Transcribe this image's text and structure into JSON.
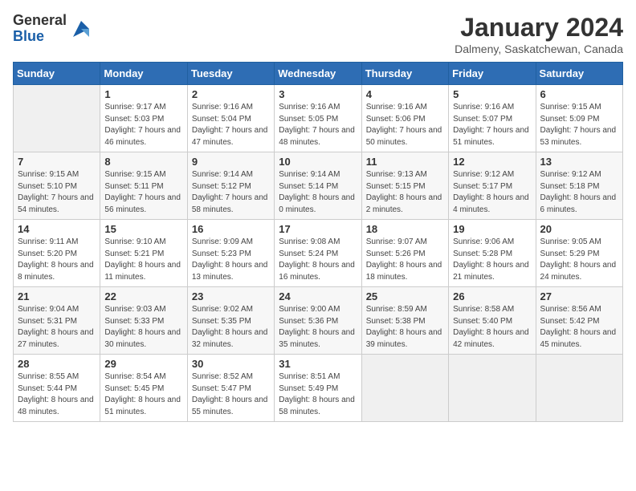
{
  "header": {
    "logo_general": "General",
    "logo_blue": "Blue",
    "month_title": "January 2024",
    "location": "Dalmeny, Saskatchewan, Canada"
  },
  "days_of_week": [
    "Sunday",
    "Monday",
    "Tuesday",
    "Wednesday",
    "Thursday",
    "Friday",
    "Saturday"
  ],
  "weeks": [
    [
      {
        "day": "",
        "sunrise": "",
        "sunset": "",
        "daylight": ""
      },
      {
        "day": "1",
        "sunrise": "Sunrise: 9:17 AM",
        "sunset": "Sunset: 5:03 PM",
        "daylight": "Daylight: 7 hours and 46 minutes."
      },
      {
        "day": "2",
        "sunrise": "Sunrise: 9:16 AM",
        "sunset": "Sunset: 5:04 PM",
        "daylight": "Daylight: 7 hours and 47 minutes."
      },
      {
        "day": "3",
        "sunrise": "Sunrise: 9:16 AM",
        "sunset": "Sunset: 5:05 PM",
        "daylight": "Daylight: 7 hours and 48 minutes."
      },
      {
        "day": "4",
        "sunrise": "Sunrise: 9:16 AM",
        "sunset": "Sunset: 5:06 PM",
        "daylight": "Daylight: 7 hours and 50 minutes."
      },
      {
        "day": "5",
        "sunrise": "Sunrise: 9:16 AM",
        "sunset": "Sunset: 5:07 PM",
        "daylight": "Daylight: 7 hours and 51 minutes."
      },
      {
        "day": "6",
        "sunrise": "Sunrise: 9:15 AM",
        "sunset": "Sunset: 5:09 PM",
        "daylight": "Daylight: 7 hours and 53 minutes."
      }
    ],
    [
      {
        "day": "7",
        "sunrise": "Sunrise: 9:15 AM",
        "sunset": "Sunset: 5:10 PM",
        "daylight": "Daylight: 7 hours and 54 minutes."
      },
      {
        "day": "8",
        "sunrise": "Sunrise: 9:15 AM",
        "sunset": "Sunset: 5:11 PM",
        "daylight": "Daylight: 7 hours and 56 minutes."
      },
      {
        "day": "9",
        "sunrise": "Sunrise: 9:14 AM",
        "sunset": "Sunset: 5:12 PM",
        "daylight": "Daylight: 7 hours and 58 minutes."
      },
      {
        "day": "10",
        "sunrise": "Sunrise: 9:14 AM",
        "sunset": "Sunset: 5:14 PM",
        "daylight": "Daylight: 8 hours and 0 minutes."
      },
      {
        "day": "11",
        "sunrise": "Sunrise: 9:13 AM",
        "sunset": "Sunset: 5:15 PM",
        "daylight": "Daylight: 8 hours and 2 minutes."
      },
      {
        "day": "12",
        "sunrise": "Sunrise: 9:12 AM",
        "sunset": "Sunset: 5:17 PM",
        "daylight": "Daylight: 8 hours and 4 minutes."
      },
      {
        "day": "13",
        "sunrise": "Sunrise: 9:12 AM",
        "sunset": "Sunset: 5:18 PM",
        "daylight": "Daylight: 8 hours and 6 minutes."
      }
    ],
    [
      {
        "day": "14",
        "sunrise": "Sunrise: 9:11 AM",
        "sunset": "Sunset: 5:20 PM",
        "daylight": "Daylight: 8 hours and 8 minutes."
      },
      {
        "day": "15",
        "sunrise": "Sunrise: 9:10 AM",
        "sunset": "Sunset: 5:21 PM",
        "daylight": "Daylight: 8 hours and 11 minutes."
      },
      {
        "day": "16",
        "sunrise": "Sunrise: 9:09 AM",
        "sunset": "Sunset: 5:23 PM",
        "daylight": "Daylight: 8 hours and 13 minutes."
      },
      {
        "day": "17",
        "sunrise": "Sunrise: 9:08 AM",
        "sunset": "Sunset: 5:24 PM",
        "daylight": "Daylight: 8 hours and 16 minutes."
      },
      {
        "day": "18",
        "sunrise": "Sunrise: 9:07 AM",
        "sunset": "Sunset: 5:26 PM",
        "daylight": "Daylight: 8 hours and 18 minutes."
      },
      {
        "day": "19",
        "sunrise": "Sunrise: 9:06 AM",
        "sunset": "Sunset: 5:28 PM",
        "daylight": "Daylight: 8 hours and 21 minutes."
      },
      {
        "day": "20",
        "sunrise": "Sunrise: 9:05 AM",
        "sunset": "Sunset: 5:29 PM",
        "daylight": "Daylight: 8 hours and 24 minutes."
      }
    ],
    [
      {
        "day": "21",
        "sunrise": "Sunrise: 9:04 AM",
        "sunset": "Sunset: 5:31 PM",
        "daylight": "Daylight: 8 hours and 27 minutes."
      },
      {
        "day": "22",
        "sunrise": "Sunrise: 9:03 AM",
        "sunset": "Sunset: 5:33 PM",
        "daylight": "Daylight: 8 hours and 30 minutes."
      },
      {
        "day": "23",
        "sunrise": "Sunrise: 9:02 AM",
        "sunset": "Sunset: 5:35 PM",
        "daylight": "Daylight: 8 hours and 32 minutes."
      },
      {
        "day": "24",
        "sunrise": "Sunrise: 9:00 AM",
        "sunset": "Sunset: 5:36 PM",
        "daylight": "Daylight: 8 hours and 35 minutes."
      },
      {
        "day": "25",
        "sunrise": "Sunrise: 8:59 AM",
        "sunset": "Sunset: 5:38 PM",
        "daylight": "Daylight: 8 hours and 39 minutes."
      },
      {
        "day": "26",
        "sunrise": "Sunrise: 8:58 AM",
        "sunset": "Sunset: 5:40 PM",
        "daylight": "Daylight: 8 hours and 42 minutes."
      },
      {
        "day": "27",
        "sunrise": "Sunrise: 8:56 AM",
        "sunset": "Sunset: 5:42 PM",
        "daylight": "Daylight: 8 hours and 45 minutes."
      }
    ],
    [
      {
        "day": "28",
        "sunrise": "Sunrise: 8:55 AM",
        "sunset": "Sunset: 5:44 PM",
        "daylight": "Daylight: 8 hours and 48 minutes."
      },
      {
        "day": "29",
        "sunrise": "Sunrise: 8:54 AM",
        "sunset": "Sunset: 5:45 PM",
        "daylight": "Daylight: 8 hours and 51 minutes."
      },
      {
        "day": "30",
        "sunrise": "Sunrise: 8:52 AM",
        "sunset": "Sunset: 5:47 PM",
        "daylight": "Daylight: 8 hours and 55 minutes."
      },
      {
        "day": "31",
        "sunrise": "Sunrise: 8:51 AM",
        "sunset": "Sunset: 5:49 PM",
        "daylight": "Daylight: 8 hours and 58 minutes."
      },
      {
        "day": "",
        "sunrise": "",
        "sunset": "",
        "daylight": ""
      },
      {
        "day": "",
        "sunrise": "",
        "sunset": "",
        "daylight": ""
      },
      {
        "day": "",
        "sunrise": "",
        "sunset": "",
        "daylight": ""
      }
    ]
  ]
}
